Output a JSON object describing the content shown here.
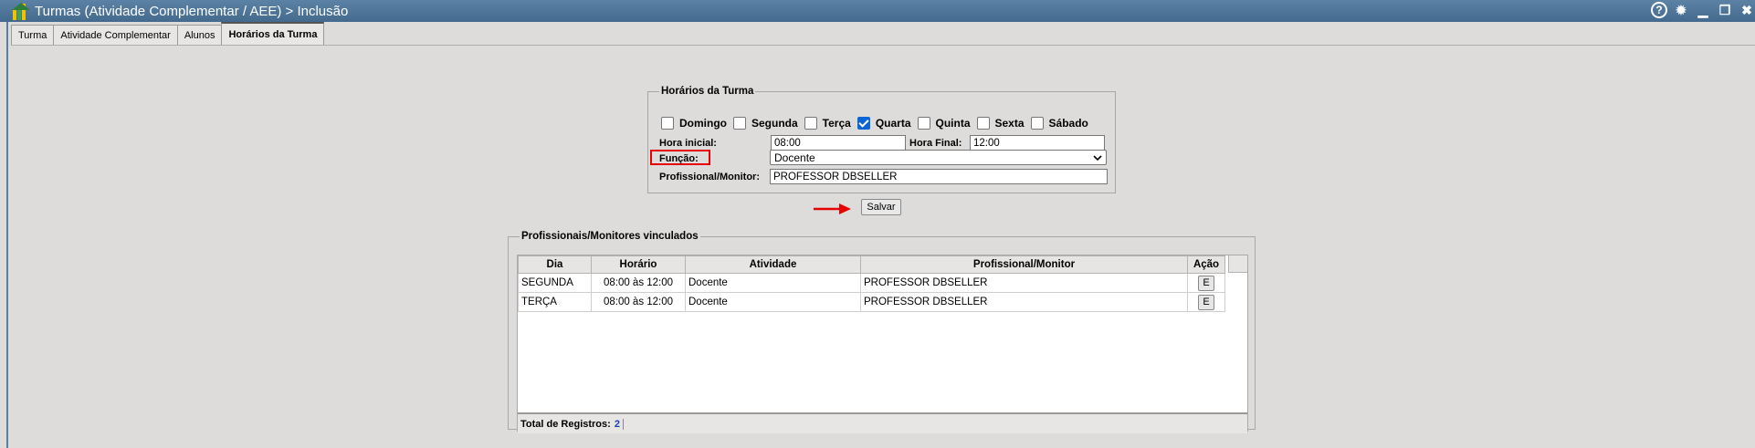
{
  "window": {
    "title": "Turmas (Atividade Complementar / AEE) > Inclusão",
    "controls": [
      "help-icon",
      "gear-icon",
      "minimize-icon",
      "restore-icon",
      "close-icon"
    ]
  },
  "tabs": [
    {
      "label": "Turma",
      "active": false
    },
    {
      "label": "Atividade Complementar",
      "active": false
    },
    {
      "label": "Alunos",
      "active": false
    },
    {
      "label": "Horários da Turma",
      "active": true
    }
  ],
  "horarios": {
    "legend": "Horários da Turma",
    "days": [
      {
        "label": "Domingo",
        "checked": false
      },
      {
        "label": "Segunda",
        "checked": false
      },
      {
        "label": "Terça",
        "checked": false
      },
      {
        "label": "Quarta",
        "checked": true
      },
      {
        "label": "Quinta",
        "checked": false
      },
      {
        "label": "Sexta",
        "checked": false
      },
      {
        "label": "Sábado",
        "checked": false
      }
    ],
    "hora_inicial_label": "Hora inicial:",
    "hora_inicial_value": "08:00",
    "hora_final_label": "Hora Final:",
    "hora_final_value": "12:00",
    "funcao_label": "Função:",
    "funcao_value": "Docente",
    "profissional_label": "Profissional/Monitor:",
    "profissional_value": "PROFESSOR DBSELLER",
    "save_label": "Salvar"
  },
  "vinculados": {
    "legend": "Profissionais/Monitores vinculados",
    "columns": [
      "Dia",
      "Horário",
      "Atividade",
      "Profissional/Monitor",
      "Ação"
    ],
    "rows": [
      {
        "dia": "SEGUNDA",
        "horario": "08:00 às 12:00",
        "atividade": "Docente",
        "profissional": "PROFESSOR DBSELLER",
        "acao": "E"
      },
      {
        "dia": "TERÇA",
        "horario": "08:00 às 12:00",
        "atividade": "Docente",
        "profissional": "PROFESSOR DBSELLER",
        "acao": "E"
      }
    ],
    "total_label": "Total de Registros:",
    "total_value": "2"
  },
  "colors": {
    "titlebar": "#4e74982",
    "highlight": "#e60000",
    "arrow": "#e60000",
    "checkbox": "#0a66d6"
  }
}
